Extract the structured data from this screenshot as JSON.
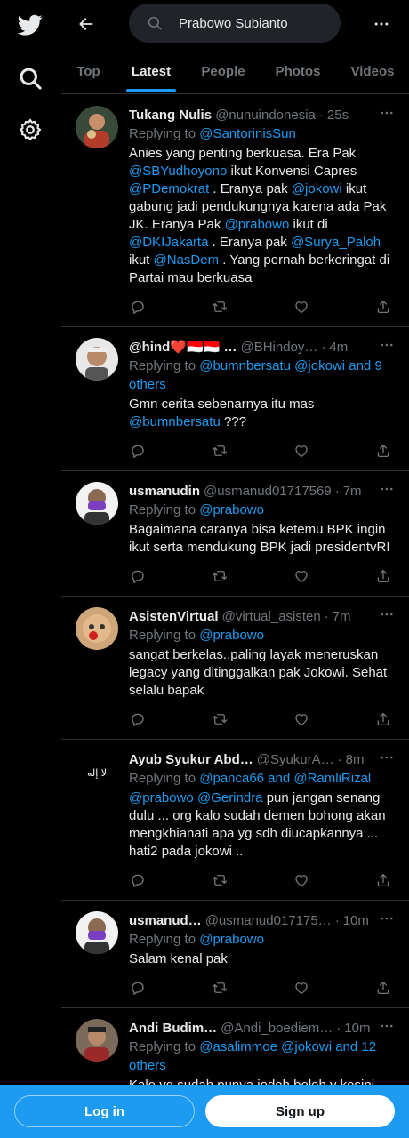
{
  "search": {
    "query": "Prabowo Subianto"
  },
  "tabs": [
    {
      "label": "Top"
    },
    {
      "label": "Latest"
    },
    {
      "label": "People"
    },
    {
      "label": "Photos"
    },
    {
      "label": "Videos"
    }
  ],
  "active_tab": "Latest",
  "tweets": [
    {
      "name": "Tukang Nulis",
      "handle": "@nunuindonesia",
      "time": "25s",
      "replying_prefix": "Replying to ",
      "replying_to": "@SantorinisSun",
      "replying_suffix": "",
      "body": [
        {
          "t": "Anies yang penting berkuasa. Era Pak "
        },
        {
          "m": "@SBYudhoyono"
        },
        {
          "t": " ikut Konvensi Capres "
        },
        {
          "m": "@PDemokrat"
        },
        {
          "t": " . Eranya pak "
        },
        {
          "m": "@jokowi"
        },
        {
          "t": " ikut gabung jadi pendukungnya karena ada Pak JK. Eranya Pak "
        },
        {
          "m": "@prabowo"
        },
        {
          "t": " ikut di "
        },
        {
          "m": "@DKIJakarta"
        },
        {
          "t": " . Eranya pak "
        },
        {
          "m": "@Surya_Paloh"
        },
        {
          "t": " ikut "
        },
        {
          "m": "@NasDem"
        },
        {
          "t": " . Yang pernah berkeringat di Partai mau berkuasa"
        }
      ]
    },
    {
      "name": "@hind❤️🇮🇩🇮🇩 …",
      "handle": "@BHindoy…",
      "time": "4m",
      "replying_prefix": "Replying to ",
      "replying_to": "@bumnbersatu @jokowi and 9 others",
      "replying_suffix": "",
      "body": [
        {
          "t": "Gmn cerita sebenarnya itu mas "
        },
        {
          "m": "@bumnbersatu"
        },
        {
          "t": " ???"
        }
      ]
    },
    {
      "name": "usmanudin",
      "handle": "@usmanud01717569",
      "time": "7m",
      "replying_prefix": "Replying to ",
      "replying_to": "@prabowo",
      "replying_suffix": "",
      "body": [
        {
          "t": "Bagaimana caranya bisa ketemu BPK ingin ikut serta mendukung BPK jadi presidentvRI"
        }
      ]
    },
    {
      "name": "AsistenVirtual",
      "handle": "@virtual_asisten",
      "time": "7m",
      "replying_prefix": "Replying to ",
      "replying_to": "@prabowo",
      "replying_suffix": "",
      "body": [
        {
          "t": "sangat berkelas..paling layak meneruskan legacy yang ditinggalkan pak Jokowi. Sehat selalu bapak"
        }
      ]
    },
    {
      "name": "Ayub Syukur Abd…",
      "handle": "@SyukurA…",
      "time": "8m",
      "replying_prefix": "Replying to ",
      "replying_to": "@panca66 and @RamliRizal",
      "replying_suffix": "",
      "body": [
        {
          "m": "@prabowo"
        },
        {
          "t": " "
        },
        {
          "m": "@Gerindra"
        },
        {
          "t": " pun jangan senang dulu ... org kalo sudah demen bohong akan mengkhianati apa yg sdh diucapkannya ... hati2 pada jokowi .."
        }
      ]
    },
    {
      "name": "usmanud…",
      "handle": "@usmanud017175…",
      "time": "10m",
      "replying_prefix": "Replying to ",
      "replying_to": "@prabowo",
      "replying_suffix": "",
      "body": [
        {
          "t": "Salam kenal  pak"
        }
      ]
    },
    {
      "name": "Andi Budim…",
      "handle": "@Andi_boediem…",
      "time": "10m",
      "replying_prefix": "Replying to ",
      "replying_to": "@asalimmoe @jokowi and 12 others",
      "replying_suffix": "",
      "body": [
        {
          "t": "Kalo yg sudah punya jodoh boleh y kesini"
        }
      ]
    }
  ],
  "bottom": {
    "login_label": "Log in",
    "signup_label": "Sign up"
  },
  "colors": {
    "accent": "#1d9bf0",
    "background": "#000000",
    "muted": "#71767b",
    "border": "#2f3336"
  },
  "icons": [
    "twitter-logo-icon",
    "search-icon",
    "settings-gear-icon",
    "back-arrow-icon",
    "more-icon",
    "reply-icon",
    "retweet-icon",
    "like-icon",
    "share-icon"
  ]
}
